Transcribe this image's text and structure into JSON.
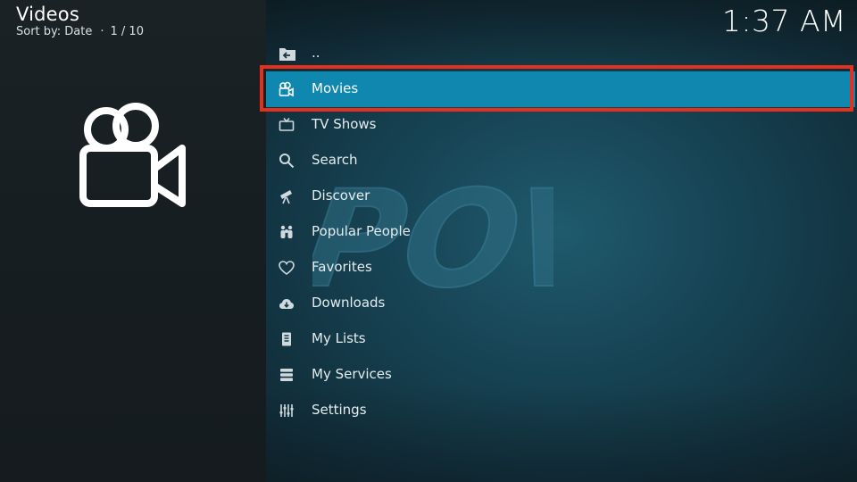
{
  "header": {
    "title": "Videos",
    "sort_label": "Sort by: Date",
    "separator": "·",
    "position": "1 / 10"
  },
  "clock": "1:37 AM",
  "watermark_text": "POV",
  "colors": {
    "selected": "#0f87ae",
    "highlight": "#e2321d",
    "text": "#e4ecef"
  },
  "menu": {
    "items": [
      {
        "label": "..",
        "icon": "folder-back-icon"
      },
      {
        "label": "Movies",
        "icon": "movie-camera-icon",
        "selected": true
      },
      {
        "label": "TV Shows",
        "icon": "tv-icon"
      },
      {
        "label": "Search",
        "icon": "search-icon"
      },
      {
        "label": "Discover",
        "icon": "telescope-icon"
      },
      {
        "label": "Popular People",
        "icon": "people-icon"
      },
      {
        "label": "Favorites",
        "icon": "heart-icon"
      },
      {
        "label": "Downloads",
        "icon": "cloud-download-icon"
      },
      {
        "label": "My Lists",
        "icon": "list-icon"
      },
      {
        "label": "My Services",
        "icon": "services-icon"
      },
      {
        "label": "Settings",
        "icon": "settings-sliders-icon"
      }
    ]
  }
}
